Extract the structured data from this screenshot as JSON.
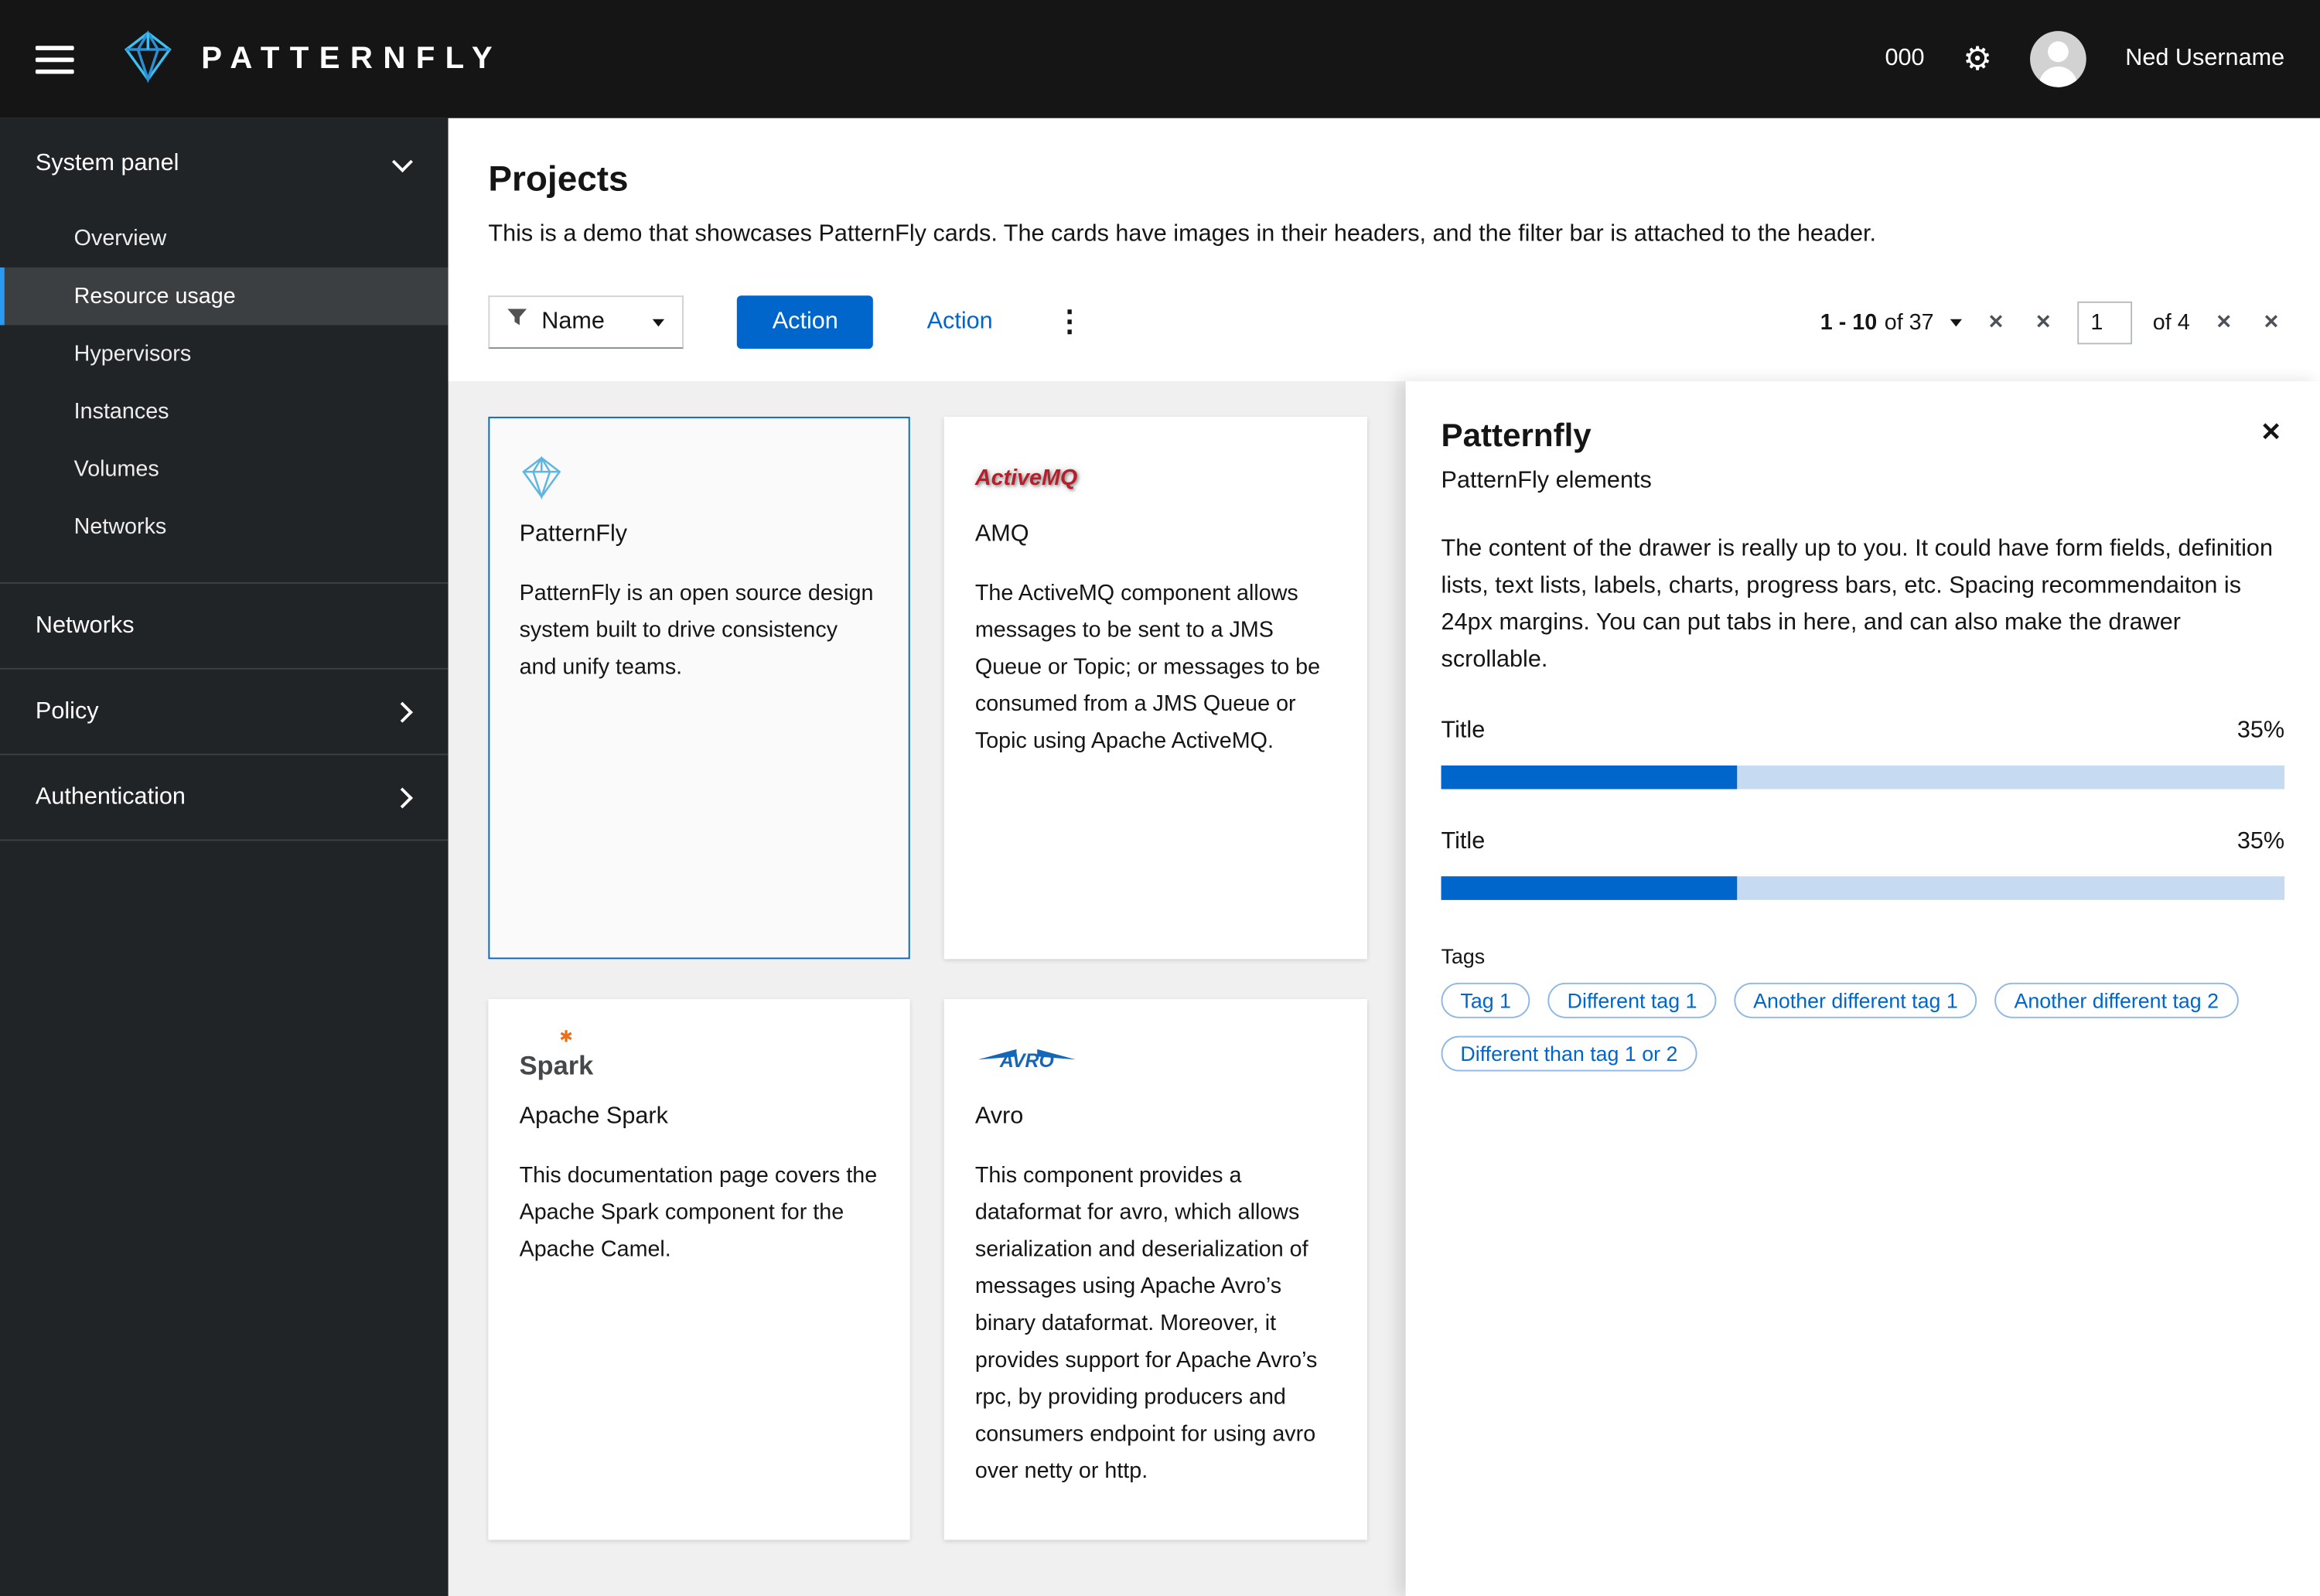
{
  "masthead": {
    "brand": "PATTERNFLY",
    "counter": "000",
    "user": "Ned Username"
  },
  "icons": {
    "settings": "⚙",
    "kebab": "⋮",
    "close": "✕",
    "nav_first": "✕",
    "nav_prev": "✕",
    "nav_next": "✕",
    "nav_last": "✕",
    "spark_star": "✱"
  },
  "sidebar": {
    "system_panel_label": "System panel",
    "sub_items": [
      "Overview",
      "Resource usage",
      "Hypervisors",
      "Instances",
      "Volumes",
      "Networks"
    ],
    "selected_item": "Resource usage",
    "networks_label": "Networks",
    "policy_label": "Policy",
    "authentication_label": "Authentication"
  },
  "page": {
    "title": "Projects",
    "description": "This is a demo that showcases PatternFly cards. The cards have images in their headers, and the filter bar is attached to the header."
  },
  "toolbar": {
    "filter_label": "Name",
    "primary_action": "Action",
    "link_action": "Action",
    "pagination": {
      "range_bold": "1 - 10",
      "range_rest": "of 37",
      "page": "1",
      "of_pages": "of 4"
    }
  },
  "cards": [
    {
      "title": "PatternFly",
      "logo_text": "",
      "body": "PatternFly is an open source design system built to drive consistency and unify teams."
    },
    {
      "title": "AMQ",
      "logo_text": "ActiveMQ",
      "body": "The ActiveMQ component allows messages to be sent to a JMS Queue or Topic; or messages to be consumed from a JMS Queue or Topic using Apache ActiveMQ."
    },
    {
      "title": "Apache Spark",
      "logo_text": "Spark",
      "body": "This documentation page covers the Apache Spark component for the Apache Camel."
    },
    {
      "title": "Avro",
      "logo_text": "AVRO",
      "body": "This component provides a dataformat for avro, which allows serialization and deserialization of messages using Apache Avro’s binary dataformat. Moreover, it provides support for Apache Avro’s rpc, by providing producers and consumers endpoint for using avro over netty or http."
    }
  ],
  "drawer": {
    "title": "Patternfly",
    "subtitle": "PatternFly elements",
    "body": "The content of the drawer is really up to you. It could have form fields, definition lists, text lists, labels, charts, progress bars, etc. Spacing recommendaiton is 24px margins. You can put tabs in here, and can also make the drawer scrollable.",
    "progress": [
      {
        "label": "Title",
        "value": "35%",
        "percent": 35
      },
      {
        "label": "Title",
        "value": "35%",
        "percent": 35
      }
    ],
    "tags_label": "Tags",
    "tags": [
      "Tag 1",
      "Different tag 1",
      "Another different tag 1",
      "Another different tag 2",
      "Different than tag 1 or 2"
    ]
  },
  "colors": {
    "primary": "#0066cc",
    "masthead_bg": "#151515",
    "sidebar_bg": "#212427",
    "selected_nav_bg": "#3c3f42",
    "nav_accent": "#2b9af3",
    "content_bg": "#f0f0f0",
    "progress_track": "#c6dbf2"
  }
}
